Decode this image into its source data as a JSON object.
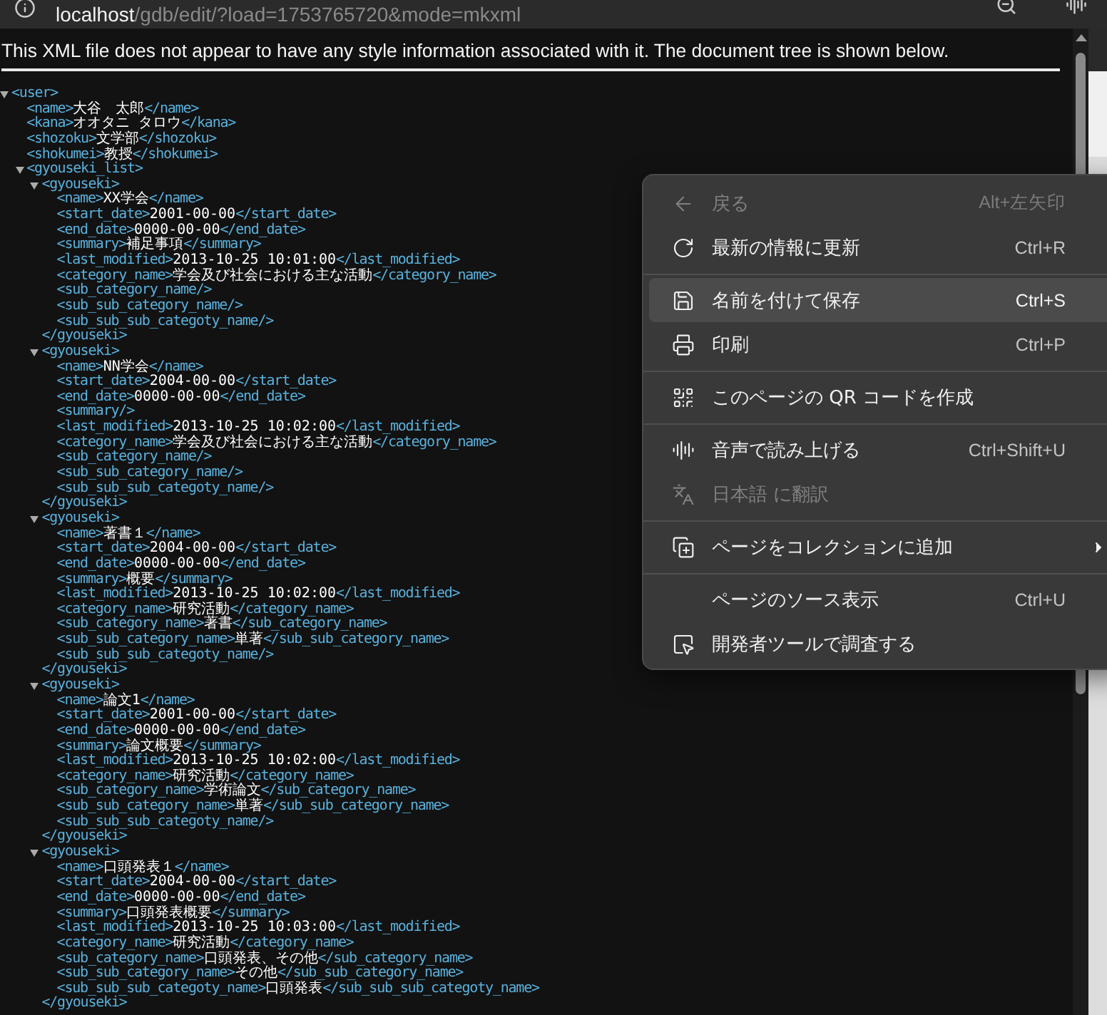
{
  "address_bar": {
    "host": "localhost",
    "path": "/gdb/edit/?load=1753765720&mode=mkxml"
  },
  "notice": "This XML file does not appear to have any style information associated with it. The document tree is shown below.",
  "xml_tree": {
    "open": "<user>",
    "expanded": true,
    "children": [
      {
        "open": "<name>",
        "text": "大谷　太郎",
        "close": "</name>"
      },
      {
        "open": "<kana>",
        "text": "オオタニ タロウ",
        "close": "</kana>"
      },
      {
        "open": "<shozoku>",
        "text": "文学部",
        "close": "</shozoku>"
      },
      {
        "open": "<shokumei>",
        "text": "教授",
        "close": "</shokumei>"
      },
      {
        "open": "<gyouseki_list>",
        "expanded": true,
        "children": [
          {
            "open": "<gyouseki>",
            "expanded": true,
            "close": "</gyouseki>",
            "children": [
              {
                "open": "<name>",
                "text": "XX学会",
                "close": "</name>"
              },
              {
                "open": "<start_date>",
                "text": "2001-00-00",
                "close": "</start_date>"
              },
              {
                "open": "<end_date>",
                "text": "0000-00-00",
                "close": "</end_date>"
              },
              {
                "open": "<summary>",
                "text": "補足事項",
                "close": "</summary>"
              },
              {
                "open": "<last_modified>",
                "text": "2013-10-25 10:01:00",
                "close": "</last_modified>"
              },
              {
                "open": "<category_name>",
                "text": "学会及び社会における主な活動",
                "close": "</category_name>"
              },
              {
                "open": "<sub_category_name/>"
              },
              {
                "open": "<sub_sub_category_name/>"
              },
              {
                "open": "<sub_sub_sub_categoty_name/>"
              }
            ]
          },
          {
            "open": "<gyouseki>",
            "expanded": true,
            "close": "</gyouseki>",
            "children": [
              {
                "open": "<name>",
                "text": "NN学会",
                "close": "</name>"
              },
              {
                "open": "<start_date>",
                "text": "2004-00-00",
                "close": "</start_date>"
              },
              {
                "open": "<end_date>",
                "text": "0000-00-00",
                "close": "</end_date>"
              },
              {
                "open": "<summary/>"
              },
              {
                "open": "<last_modified>",
                "text": "2013-10-25 10:02:00",
                "close": "</last_modified>"
              },
              {
                "open": "<category_name>",
                "text": "学会及び社会における主な活動",
                "close": "</category_name>"
              },
              {
                "open": "<sub_category_name/>"
              },
              {
                "open": "<sub_sub_category_name/>"
              },
              {
                "open": "<sub_sub_sub_categoty_name/>"
              }
            ]
          },
          {
            "open": "<gyouseki>",
            "expanded": true,
            "close": "</gyouseki>",
            "children": [
              {
                "open": "<name>",
                "text": "著書１",
                "close": "</name>"
              },
              {
                "open": "<start_date>",
                "text": "2004-00-00",
                "close": "</start_date>"
              },
              {
                "open": "<end_date>",
                "text": "0000-00-00",
                "close": "</end_date>"
              },
              {
                "open": "<summary>",
                "text": "概要",
                "close": "</summary>"
              },
              {
                "open": "<last_modified>",
                "text": "2013-10-25 10:02:00",
                "close": "</last_modified>"
              },
              {
                "open": "<category_name>",
                "text": "研究活動",
                "close": "</category_name>"
              },
              {
                "open": "<sub_category_name>",
                "text": "著書",
                "close": "</sub_category_name>"
              },
              {
                "open": "<sub_sub_category_name>",
                "text": "単著",
                "close": "</sub_sub_category_name>"
              },
              {
                "open": "<sub_sub_sub_categoty_name/>"
              }
            ]
          },
          {
            "open": "<gyouseki>",
            "expanded": true,
            "close": "</gyouseki>",
            "children": [
              {
                "open": "<name>",
                "text": "論文1",
                "close": "</name>"
              },
              {
                "open": "<start_date>",
                "text": "2001-00-00",
                "close": "</start_date>"
              },
              {
                "open": "<end_date>",
                "text": "0000-00-00",
                "close": "</end_date>"
              },
              {
                "open": "<summary>",
                "text": "論文概要",
                "close": "</summary>"
              },
              {
                "open": "<last_modified>",
                "text": "2013-10-25 10:02:00",
                "close": "</last_modified>"
              },
              {
                "open": "<category_name>",
                "text": "研究活動",
                "close": "</category_name>"
              },
              {
                "open": "<sub_category_name>",
                "text": "学術論文",
                "close": "</sub_category_name>"
              },
              {
                "open": "<sub_sub_category_name>",
                "text": "単著",
                "close": "</sub_sub_category_name>"
              },
              {
                "open": "<sub_sub_sub_categoty_name/>"
              }
            ]
          },
          {
            "open": "<gyouseki>",
            "expanded": true,
            "close": "</gyouseki>",
            "children": [
              {
                "open": "<name>",
                "text": "口頭発表１",
                "close": "</name>"
              },
              {
                "open": "<start_date>",
                "text": "2004-00-00",
                "close": "</start_date>"
              },
              {
                "open": "<end_date>",
                "text": "0000-00-00",
                "close": "</end_date>"
              },
              {
                "open": "<summary>",
                "text": "口頭発表概要",
                "close": "</summary>"
              },
              {
                "open": "<last_modified>",
                "text": "2013-10-25 10:03:00",
                "close": "</last_modified>"
              },
              {
                "open": "<category_name>",
                "text": "研究活動",
                "close": "</category_name>"
              },
              {
                "open": "<sub_category_name>",
                "text": "口頭発表、その他",
                "close": "</sub_category_name>"
              },
              {
                "open": "<sub_sub_category_name>",
                "text": "その他",
                "close": "</sub_sub_category_name>"
              },
              {
                "open": "<sub_sub_sub_categoty_name>",
                "text": "口頭発表",
                "close": "</sub_sub_sub_categoty_name>"
              }
            ]
          }
        ]
      }
    ]
  },
  "context_menu": [
    {
      "kind": "item",
      "label": "戻る",
      "shortcut": "Alt+左矢印",
      "disabled": true,
      "selected": false
    },
    {
      "kind": "item",
      "label": "最新の情報に更新",
      "shortcut": "Ctrl+R",
      "disabled": false,
      "selected": false
    },
    {
      "kind": "separator"
    },
    {
      "kind": "item",
      "label": "名前を付けて保存",
      "shortcut": "Ctrl+S",
      "disabled": false,
      "selected": true
    },
    {
      "kind": "item",
      "label": "印刷",
      "shortcut": "Ctrl+P",
      "disabled": false,
      "selected": false
    },
    {
      "kind": "separator"
    },
    {
      "kind": "item",
      "label": "このページの QR コードを作成",
      "disabled": false,
      "selected": false
    },
    {
      "kind": "separator"
    },
    {
      "kind": "item",
      "label": "音声で読み上げる",
      "shortcut": "Ctrl+Shift+U",
      "disabled": false,
      "selected": false
    },
    {
      "kind": "item",
      "label": "日本語 に翻訳",
      "disabled": true,
      "selected": false
    },
    {
      "kind": "separator"
    },
    {
      "kind": "item",
      "label": "ページをコレクションに追加",
      "disabled": false,
      "selected": false,
      "submenu": true
    },
    {
      "kind": "separator"
    },
    {
      "kind": "item",
      "label": "ページのソース表示",
      "shortcut": "Ctrl+U",
      "disabled": false,
      "selected": false
    },
    {
      "kind": "item",
      "label": "開発者ツールで調査する",
      "disabled": false,
      "selected": false
    }
  ]
}
